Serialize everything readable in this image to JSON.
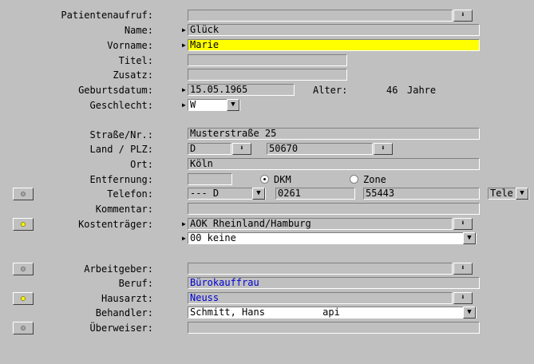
{
  "labels": {
    "patientenaufruf": "Patientenaufruf:",
    "name": "Name:",
    "vorname": "Vorname:",
    "titel": "Titel:",
    "zusatz": "Zusatz:",
    "geburtsdatum": "Geburtsdatum:",
    "geschlecht": "Geschlecht:",
    "strasse": "Straße/Nr.:",
    "land_plz": "Land / PLZ:",
    "ort": "Ort:",
    "entfernung": "Entfernung:",
    "telefon": "Telefon:",
    "kommentar": "Kommentar:",
    "kostentraeger": "Kostenträger:",
    "arbeitgeber": "Arbeitgeber:",
    "beruf": "Beruf:",
    "hausarzt": "Hausarzt:",
    "behandler": "Behandler:",
    "ueberweiser": "Überweiser:"
  },
  "values": {
    "patientenaufruf": "",
    "name": "Glück",
    "vorname": "Marie",
    "titel": "",
    "zusatz": "",
    "geburtsdatum": "15.05.1965",
    "alter_label": "Alter:",
    "alter_value": "46",
    "alter_unit": "Jahre",
    "geschlecht": "W",
    "strasse": "Musterstraße 25",
    "land": "D",
    "plz": "50670",
    "ort": "Köln",
    "entfernung": "",
    "dkm_label": "DKM",
    "zone_label": "Zone",
    "telefon_type": "--- D",
    "telefon_vorwahl": "0261",
    "telefon_nummer": "55443",
    "telefon_kind": "Tele",
    "kommentar": "",
    "kostentraeger": "AOK Rheinland/Hamburg",
    "kostentraeger_status": "00 keine",
    "arbeitgeber": "",
    "beruf": "Bürokauffrau",
    "hausarzt": "Neuss",
    "behandler": "Schmitt, Hans          api",
    "ueberweiser": ""
  },
  "icons": {
    "dropdown_arrow": "⬇",
    "combo_arrow": "▼",
    "marker": "▶"
  },
  "colors": {
    "background": "#c0c0c0",
    "highlight": "#ffff00",
    "link_text": "#0000d0"
  }
}
